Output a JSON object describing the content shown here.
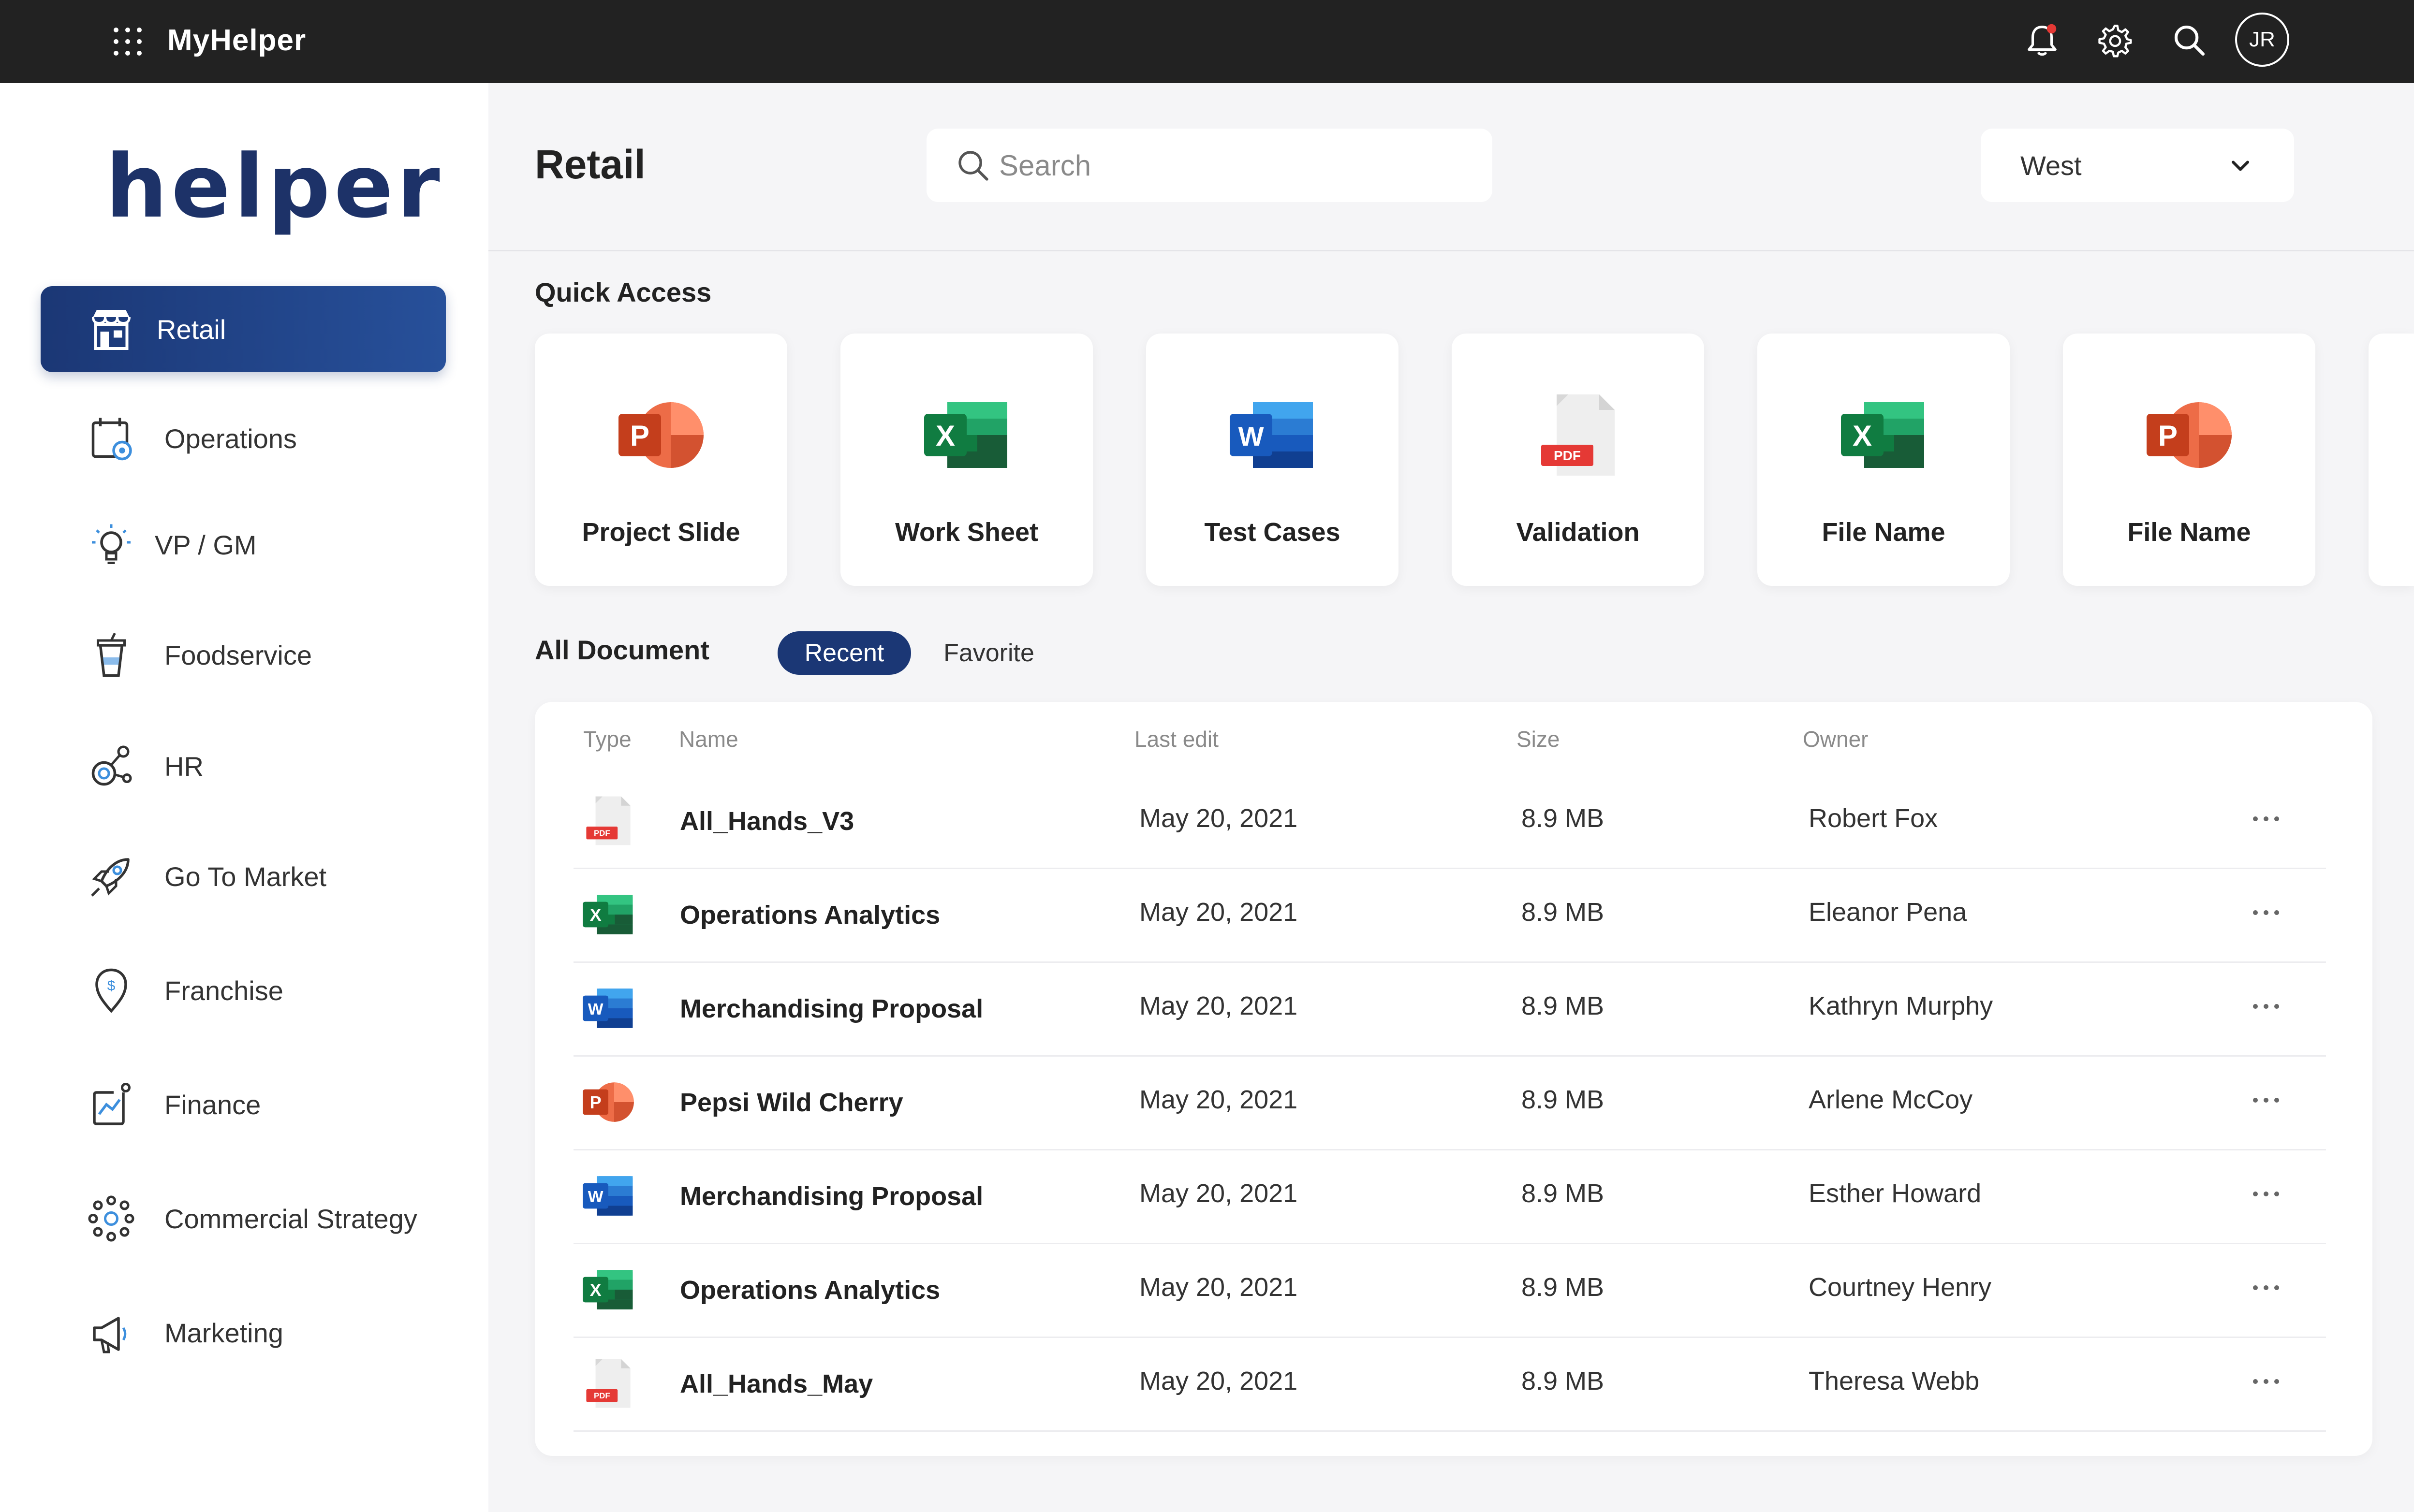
{
  "topbar": {
    "app_title": "MyHelper",
    "avatar_initials": "JR",
    "icons": [
      "apps-grid-icon",
      "bell-icon",
      "gear-icon",
      "search-icon"
    ],
    "notification_dot_color": "#e53935"
  },
  "sidebar": {
    "brand": "helper",
    "brand_color": "#1d3268",
    "accent_color": "#1b3775",
    "items": [
      {
        "label": "Retail",
        "icon": "store-icon",
        "active": true
      },
      {
        "label": "Operations",
        "icon": "calendar-gear-icon"
      },
      {
        "label": "VP / GM",
        "icon": "lightbulb-icon"
      },
      {
        "label": "Foodservice",
        "icon": "cup-icon"
      },
      {
        "label": "HR",
        "icon": "people-network-icon"
      },
      {
        "label": "Go To Market",
        "icon": "rocket-icon"
      },
      {
        "label": "Franchise",
        "icon": "location-dollar-icon"
      },
      {
        "label": "Finance",
        "icon": "chart-growth-icon"
      },
      {
        "label": "Commercial Strategy",
        "icon": "strategy-network-icon"
      },
      {
        "label": "Marketing",
        "icon": "megaphone-icon"
      }
    ]
  },
  "header": {
    "title": "Retail",
    "search_placeholder": "Search",
    "region": "West"
  },
  "quick_access": {
    "title": "Quick Access",
    "cards": [
      {
        "label": "Project Slide",
        "type": "powerpoint-icon"
      },
      {
        "label": "Work Sheet",
        "type": "excel-icon"
      },
      {
        "label": "Test Cases",
        "type": "word-icon"
      },
      {
        "label": "Validation",
        "type": "pdf-icon"
      },
      {
        "label": "File Name",
        "type": "excel-icon"
      },
      {
        "label": "File Name",
        "type": "powerpoint-icon"
      }
    ]
  },
  "documents": {
    "title": "All Document",
    "tabs": [
      {
        "label": "Recent",
        "active": true
      },
      {
        "label": "Favorite"
      }
    ],
    "columns": [
      "Type",
      "Name",
      "Last edit",
      "Size",
      "Owner"
    ],
    "rows": [
      {
        "type": "pdf-icon",
        "name": "All_Hands_V3",
        "last_edit": "May 20, 2021",
        "size": "8.9 MB",
        "owner": "Robert Fox"
      },
      {
        "type": "excel-icon",
        "name": "Operations Analytics",
        "last_edit": "May 20, 2021",
        "size": "8.9 MB",
        "owner": "Eleanor Pena"
      },
      {
        "type": "word-icon",
        "name": "Merchandising Proposal",
        "last_edit": "May 20, 2021",
        "size": "8.9 MB",
        "owner": "Kathryn Murphy"
      },
      {
        "type": "powerpoint-icon",
        "name": "Pepsi Wild Cherry",
        "last_edit": "May 20, 2021",
        "size": "8.9 MB",
        "owner": "Arlene McCoy"
      },
      {
        "type": "word-icon",
        "name": "Merchandising Proposal",
        "last_edit": "May 20, 2021",
        "size": "8.9 MB",
        "owner": "Esther Howard"
      },
      {
        "type": "excel-icon",
        "name": "Operations Analytics",
        "last_edit": "May 20, 2021",
        "size": "8.9 MB",
        "owner": "Courtney Henry"
      },
      {
        "type": "pdf-icon",
        "name": "All_Hands_May",
        "last_edit": "May 20, 2021",
        "size": "8.9 MB",
        "owner": "Theresa Webb"
      }
    ]
  }
}
